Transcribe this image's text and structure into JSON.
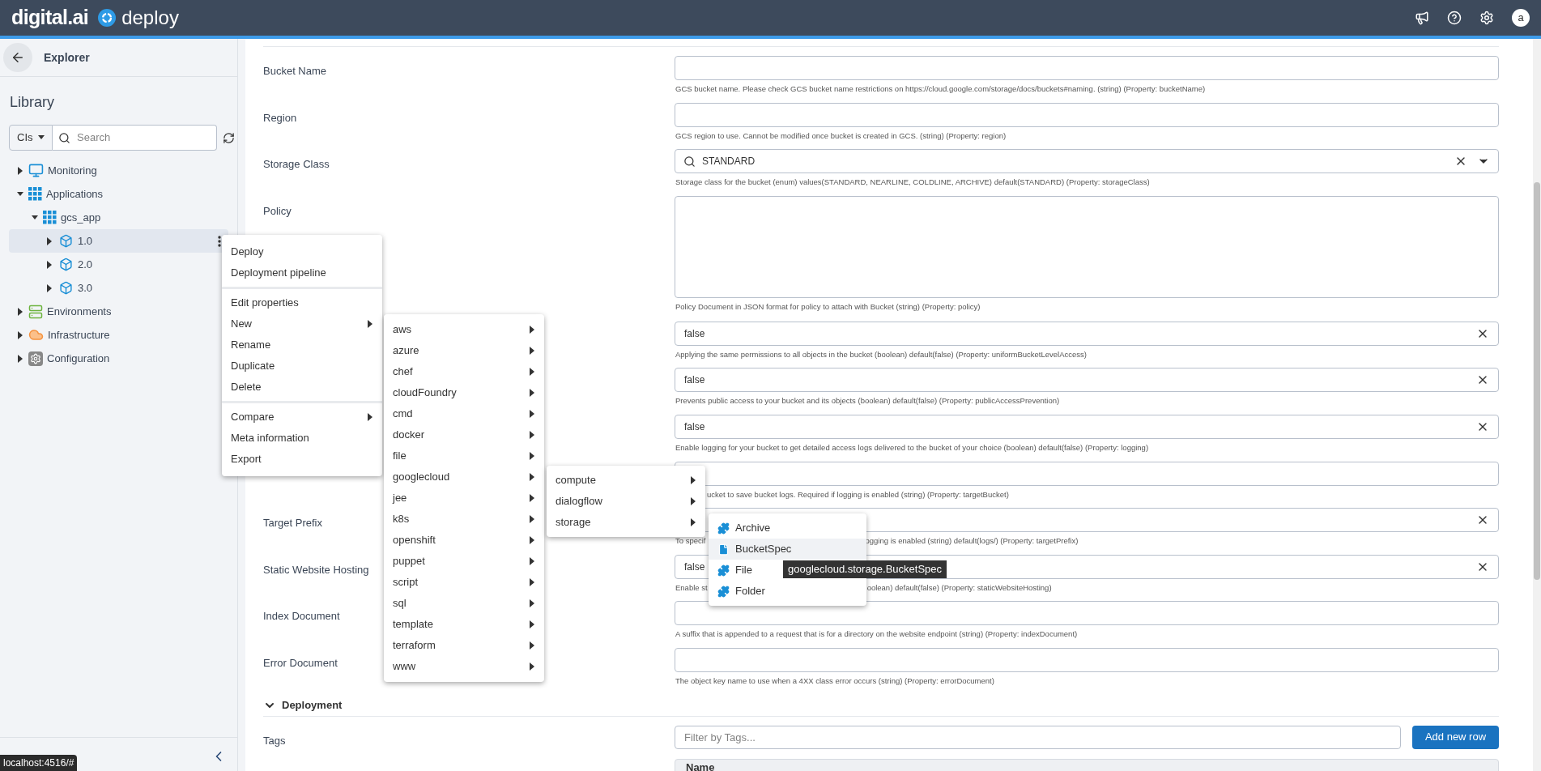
{
  "header": {
    "brand": "digital.ai",
    "product": "deploy",
    "avatar": "a"
  },
  "sidebar": {
    "back_title": "Explorer",
    "library_title": "Library",
    "type_filter": "CIs",
    "search": {
      "placeholder": "Search"
    },
    "tree": [
      {
        "label": "Monitoring",
        "kind": "monitor",
        "expanded": false,
        "selected": false
      },
      {
        "label": "Applications",
        "kind": "grid",
        "expanded": true,
        "selected": false,
        "children": [
          {
            "label": "gcs_app",
            "kind": "grid",
            "expanded": true,
            "selected": false,
            "children": [
              {
                "label": "1.0",
                "kind": "box",
                "expanded": false,
                "selected": true
              },
              {
                "label": "2.0",
                "kind": "box",
                "expanded": false,
                "selected": false
              },
              {
                "label": "3.0",
                "kind": "box",
                "expanded": false,
                "selected": false
              }
            ]
          }
        ]
      },
      {
        "label": "Environments",
        "kind": "servers",
        "expanded": false,
        "selected": false
      },
      {
        "label": "Infrastructure",
        "kind": "cloud",
        "expanded": false,
        "selected": false
      },
      {
        "label": "Configuration",
        "kind": "gear",
        "expanded": false,
        "selected": false
      }
    ],
    "status_url": "localhost:4516/#"
  },
  "form": {
    "fields": [
      {
        "label": "Bucket Name",
        "kind": "text",
        "clearable": false,
        "help": [
          "GCS bucket name. Please check GCS bucket name restrictions on https://cloud.google.com/storage/docs/buckets#naming. (string) (Property: bucketName)"
        ]
      },
      {
        "label": "Region",
        "kind": "text",
        "clearable": false,
        "help": [
          "GCS region to use. Cannot be modified once bucket is created in GCS. (string) (Property: region)"
        ]
      },
      {
        "label": "Storage Class",
        "kind": "select",
        "value": "STANDARD",
        "clearable": true,
        "help": [
          "Storage class for the bucket (enum) values(STANDARD, NEARLINE, COLDLINE, ARCHIVE) default(STANDARD) (Property: storageClass)"
        ]
      },
      {
        "label": "Policy",
        "kind": "textarea",
        "help": [
          "Policy Document in JSON format for policy to attach with Bucket (string) (Property: policy)"
        ]
      },
      {
        "kind": "text",
        "value": "false",
        "clearable": true,
        "help": [
          "Applying the same permissions to all objects in the bucket (boolean) default(false) (Property: uniformBucketLevelAccess)"
        ]
      },
      {
        "kind": "text",
        "value": "false",
        "clearable": true,
        "help": [
          "Prevents public access to your bucket and its objects (boolean) default(false) (Property: publicAccessPrevention)"
        ]
      },
      {
        "kind": "text",
        "value": "false",
        "clearable": true,
        "help": [
          "Enable logging for your bucket to get detailed access logs delivered to the bucket of your choice (boolean) default(false) (Property: logging)"
        ]
      },
      {
        "kind": "text",
        "clearable": false,
        "help_start_hidden": true,
        "help": [
          "ucket to save bucket logs. Required if logging is enabled (string) (Property: targetBucket)"
        ]
      },
      {
        "label": "Target Prefix",
        "kind": "text",
        "clearable": true,
        "help": [
          "To specif",
          "ogging is enabled (string) default(logs/) (Property: targetPrefix)"
        ]
      },
      {
        "label": "Static Website Hosting",
        "kind": "text",
        "value": "false",
        "clearable": true,
        "help": [
          "Enable st",
          "oolean) default(false) (Property: staticWebsiteHosting)"
        ]
      },
      {
        "label": "Index Document",
        "kind": "text",
        "clearable": false,
        "help": [
          "A suffix that is appended to a request that is for a directory on the website endpoint (string) (Property: indexDocument)"
        ]
      },
      {
        "label": "Error Document",
        "kind": "text",
        "clearable": false,
        "help": [
          "The object key name to use when a 4XX class error occurs (string) (Property: errorDocument)"
        ]
      }
    ],
    "section": {
      "title": "Deployment",
      "expanded": true
    },
    "tags": {
      "label": "Tags",
      "filter": {
        "placeholder": "Filter by Tags..."
      },
      "add_button": "Add new row",
      "columns": [
        "Name"
      ]
    }
  },
  "context_menu": {
    "groups": [
      [
        {
          "label": "Deploy",
          "submenu": false
        },
        {
          "label": "Deployment pipeline",
          "submenu": false
        }
      ],
      [
        {
          "label": "Edit properties",
          "submenu": false
        },
        {
          "label": "New",
          "submenu": true
        },
        {
          "label": "Rename",
          "submenu": false
        },
        {
          "label": "Duplicate",
          "submenu": false
        },
        {
          "label": "Delete",
          "submenu": false
        }
      ],
      [
        {
          "label": "Compare",
          "submenu": true
        },
        {
          "label": "Meta information",
          "submenu": false
        },
        {
          "label": "Export",
          "submenu": false
        }
      ]
    ]
  },
  "new_menu": [
    "aws",
    "azure",
    "chef",
    "cloudFoundry",
    "cmd",
    "docker",
    "file",
    "googlecloud",
    "jee",
    "k8s",
    "openshift",
    "puppet",
    "script",
    "sql",
    "template",
    "terraform",
    "www"
  ],
  "googlecloud_menu": [
    "compute",
    "dialogflow",
    "storage"
  ],
  "storage_menu": [
    {
      "label": "Archive",
      "kind": "puzzle",
      "selected": false
    },
    {
      "label": "BucketSpec",
      "kind": "file",
      "selected": true
    },
    {
      "label": "File",
      "kind": "puzzle",
      "selected": false
    },
    {
      "label": "Folder",
      "kind": "puzzle",
      "selected": false
    }
  ],
  "tooltip": "googlecloud.storage.BucketSpec"
}
